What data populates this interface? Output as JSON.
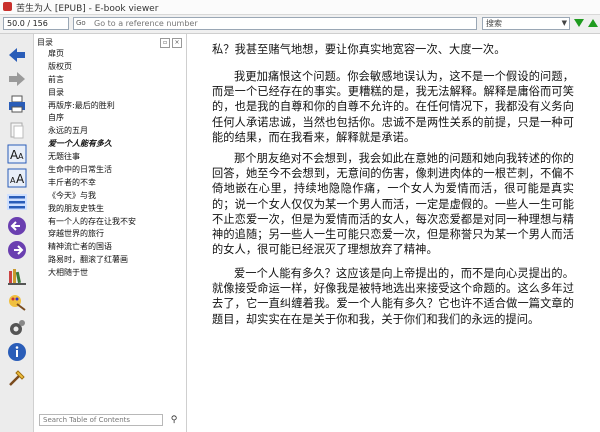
{
  "window": {
    "title": "苦生为人 [EPUB] - E-book viewer"
  },
  "toolbar": {
    "position_value": "50.0  /  156",
    "reference_placeholder": "Go to a reference number",
    "search_value": "搜索"
  },
  "sidebar_icons": [
    "back-arrow-icon",
    "forward-arrow-icon",
    "print-icon",
    "copy-icon",
    "font-larger-icon",
    "font-smaller-icon",
    "toc-icon",
    "previous-page-icon",
    "next-page-icon",
    "library-icon",
    "theme-icon",
    "preferences-icon",
    "info-icon",
    "fullscreen-icon"
  ],
  "toc": {
    "header": "目录",
    "items": [
      "扉页",
      "版权页",
      "前言",
      "目录",
      "再版序:最后的胜利",
      "自序",
      "永远的五月",
      "爱一个人能有多久",
      "无题往事",
      "生命中的日常生活",
      "丰斤者的不幸",
      "《今天》与我",
      "我的朋友史铁生",
      "有一个人的存在让我不安",
      "穿越世界的旅行",
      "精神流亡者的国语",
      "路易时，翻滚了红薯画",
      "大相随于世"
    ],
    "current_index": 7,
    "search_placeholder": "Search Table of Contents"
  },
  "content": {
    "paragraphs": [
      "私？我甚至赌气地想，要让你真实地宽容一次、大度一次。",
      "我更加痛恨这个问题。你会敏感地误认为，这不是一个假设的问题，而是一个已经存在的事实。更糟糕的是，我无法解释。解释是庸俗而可笑的，也是我的自尊和你的自尊不允许的。在任何情况下，我都没有义务向任何人承诺忠诚，当然也包括你。忠诚不是两性关系的前提，只是一种可能的结果，而在我看来，解释就是承诺。",
      "那个朋友绝对不会想到，我会如此在意她的问题和她向我转述的你的回答，她至今不会想到，无意间的伤害，像刺进肉体的一根芒刺，不偏不倚地嵌在心里，持续地隐隐作痛，一个女人为爱情而活，很可能是真实的；说一个女人仅仅为某一个男人而活，一定是虚假的。一些人一生可能不止恋爱一次，但是为爱情而活的女人，每次恋爱都是对同一种理想与精神的追随；另一些人一生可能只恋爱一次，但是称誉只为某一个男人而活的女人，很可能已经泯灭了理想放弃了精神。",
      "爱一个人能有多久？这应该是向上帝提出的，而不是向心灵提出的。就像接受命运一样，好像我是被特地选出来接受这个命题的。这么多年过去了，它一直纠缠着我。爱一个人能有多久？它也许不适合做一篇文章的题目，却实实在在是关于你和我，关于你们和我们的永远的提问。"
    ]
  },
  "colors": {
    "accent_green": "#1f9b1f",
    "icon_blue": "#2a5db8",
    "icon_purple": "#6a3fb0"
  }
}
